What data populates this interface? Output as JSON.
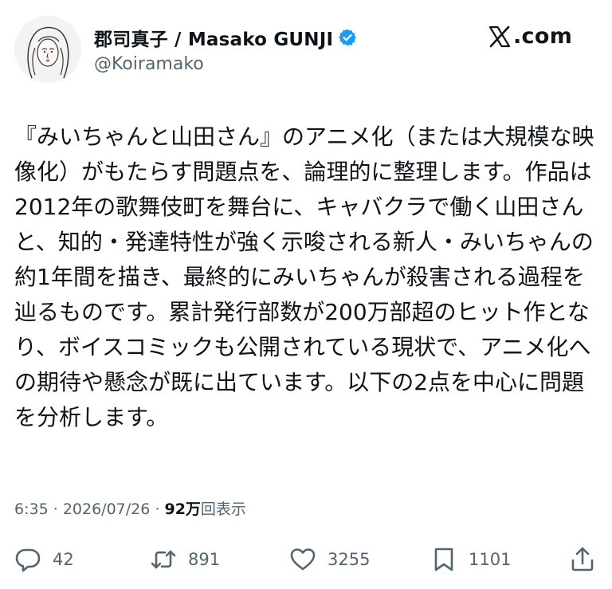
{
  "author": {
    "display_name": "郡司真子 / Masako GUNJI",
    "handle": "@Koiramako",
    "avatar_icon": "illustrated-portrait-avatar",
    "verified_icon": "verified-badge-icon",
    "verified_color": "#1d9bf0"
  },
  "brand": {
    "logo_icon": "x-logo-icon",
    "domain": ".com"
  },
  "tweet": {
    "text": "『みいちゃんと山田さん』のアニメ化（または大規模な映像化）がもたらす問題点を、論理的に整理します。作品は2012年の歌舞伎町を舞台に、キャバクラで働く山田さんと、知的・発達特性が強く示唆される新人・みいちゃんの約1年間を描き、最終的にみいちゃんが殺害される過程を辿るものです。累計発行部数が200万部超のヒット作となり、ボイスコミックも公開されている現状で、アニメ化への期待や懸念が既に出ています。以下の2点を中心に問題を分析します。"
  },
  "meta": {
    "time": "6:35",
    "separator": "·",
    "date": "2026/07/26",
    "views_count": "92万",
    "views_label": "回表示"
  },
  "actions": {
    "reply": {
      "icon": "reply-bubble-icon",
      "count": "42"
    },
    "repost": {
      "icon": "repost-icon",
      "count": "891"
    },
    "like": {
      "icon": "heart-icon",
      "count": "3255"
    },
    "bookmark": {
      "icon": "bookmark-icon",
      "count": "1101"
    },
    "share": {
      "icon": "share-icon"
    }
  },
  "colors": {
    "text": "#0f1419",
    "secondary": "#536471"
  }
}
